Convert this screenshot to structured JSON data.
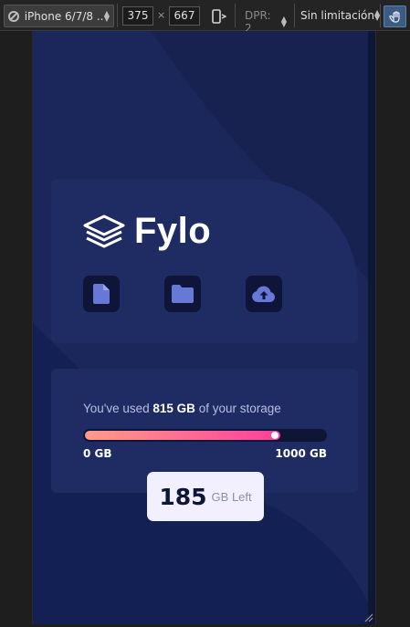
{
  "devtools": {
    "device_label": "iPhone 6/7/8 ...",
    "width": "375",
    "times": "×",
    "height": "667",
    "dpr_label": "DPR: 2",
    "throttle_label": "Sin limitación"
  },
  "app": {
    "brand": "Fylo",
    "icons": [
      "document-icon",
      "folder-icon",
      "upload-icon"
    ],
    "storage": {
      "prefix": "You've used ",
      "used": "815 GB",
      "suffix": " of your storage",
      "min_label": "0 GB",
      "max_label": "1000 GB",
      "used_fraction": 0.815,
      "left_value": "185",
      "left_unit": "GB Left"
    }
  },
  "colors": {
    "background": "#172251",
    "card": "#1f2b63",
    "accent_start": "#ff9b8a",
    "accent_end": "#ff3f9c",
    "icon": "#6878d6"
  }
}
